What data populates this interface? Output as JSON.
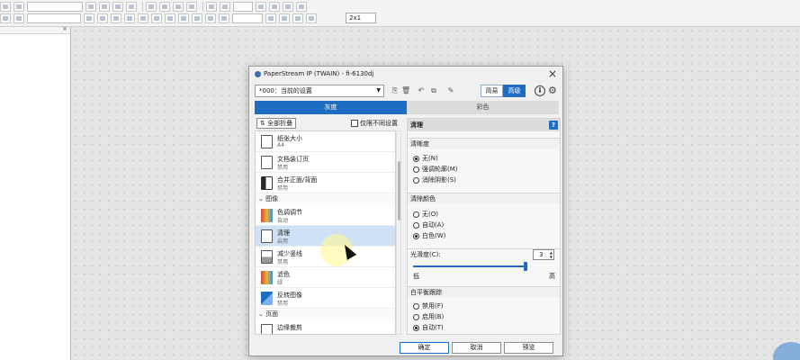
{
  "toolbar": {
    "zoom_value": "2x1"
  },
  "dialog": {
    "title": "PaperStream IP (TWAIN) - fi-6130dj",
    "profile_value": "*000：当前的设置",
    "mode_basic": "简易",
    "mode_advanced": "高级",
    "tabs": [
      {
        "label": "灰度"
      },
      {
        "label": "彩色"
      }
    ],
    "collapse_all": "全部折叠",
    "only_diff": "仅限不同设置",
    "features": [
      {
        "name": "纸张大小",
        "value": "A4"
      },
      {
        "name": "文档装订页",
        "value": "禁用"
      },
      {
        "name": "合并正面/背面",
        "value": "禁用"
      },
      {
        "section": "图像"
      },
      {
        "name": "色调调节",
        "value": "自动"
      },
      {
        "name": "清理",
        "value": "启用"
      },
      {
        "name": "减少竖线",
        "value": "禁用"
      },
      {
        "name": "滤色",
        "value": "绿"
      },
      {
        "name": "反转图像",
        "value": "禁用"
      },
      {
        "section": "页面"
      },
      {
        "name": "边缘裁剪",
        "value": ""
      }
    ],
    "panel": {
      "title": "清理",
      "sharpness_label": "清晰度",
      "sharpness_options": [
        "无(N)",
        "强调轮廓(M)",
        "消除阴影(S)"
      ],
      "sharpness_selected": 0,
      "remove_color_label": "清除颜色",
      "remove_color_options": [
        "无(O)",
        "自动(A)",
        "白色(W)"
      ],
      "remove_color_selected": 2,
      "smoothness_label": "光滑度(C):",
      "smoothness_value": "3",
      "slider_low": "低",
      "slider_high": "高",
      "white_balance_label": "白平衡跟踪",
      "white_balance_options": [
        "禁用(F)",
        "启用(B)",
        "自动(T)"
      ],
      "white_balance_selected": 2
    },
    "buttons": {
      "ok": "确定",
      "cancel": "取消",
      "preview": "预览"
    }
  }
}
